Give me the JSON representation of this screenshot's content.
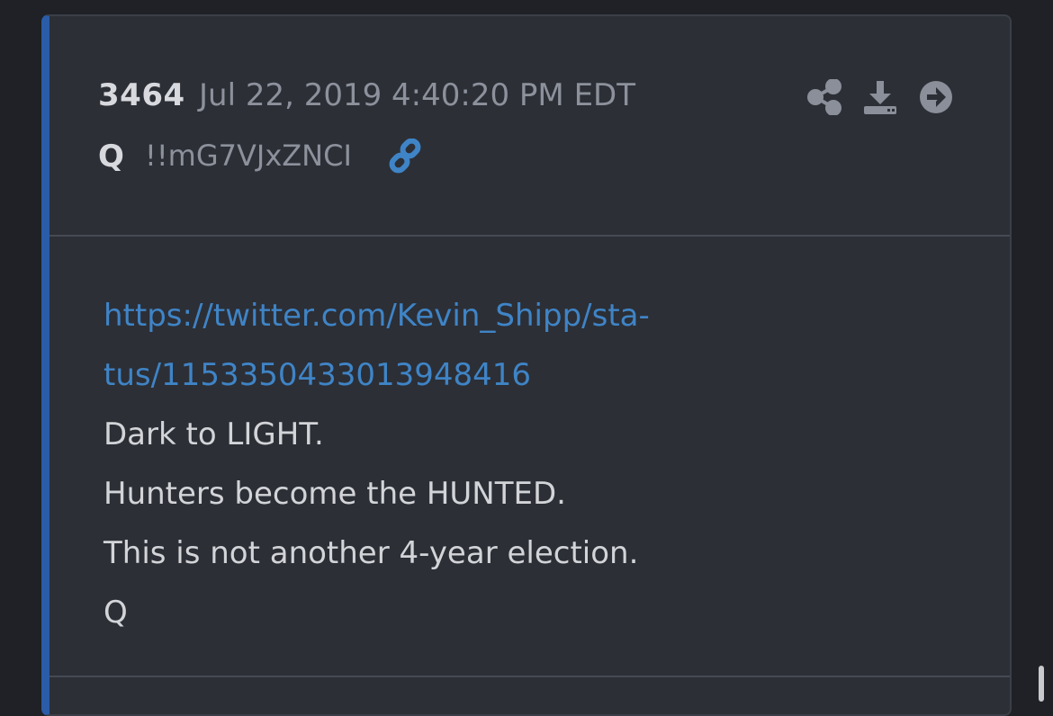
{
  "post": {
    "number": "3464",
    "timestamp": "Jul 22, 2019 4:40:20 PM EDT",
    "author": "Q",
    "tripcode": "!!mG7VJxZNCI",
    "link_icon": "link-icon",
    "actions": [
      {
        "name": "share-icon"
      },
      {
        "name": "download-icon"
      },
      {
        "name": "arrow-right-circle-icon"
      }
    ],
    "body": {
      "url_line_1": "https://twitter.com/Kevin_Shipp/sta-",
      "url_line_2": "tus/1153350433013948416",
      "lines": [
        "Dark to LIGHT.",
        "Hunters become the HUNTED.",
        "This is not another 4-year election.",
        "Q"
      ]
    }
  },
  "colors": {
    "background": "#1f2126",
    "card": "#2c2f36",
    "accent_bar": "#2a5ca8",
    "link": "#3f84c6",
    "muted_text": "#8c919b",
    "icon": "#8a8f99"
  }
}
